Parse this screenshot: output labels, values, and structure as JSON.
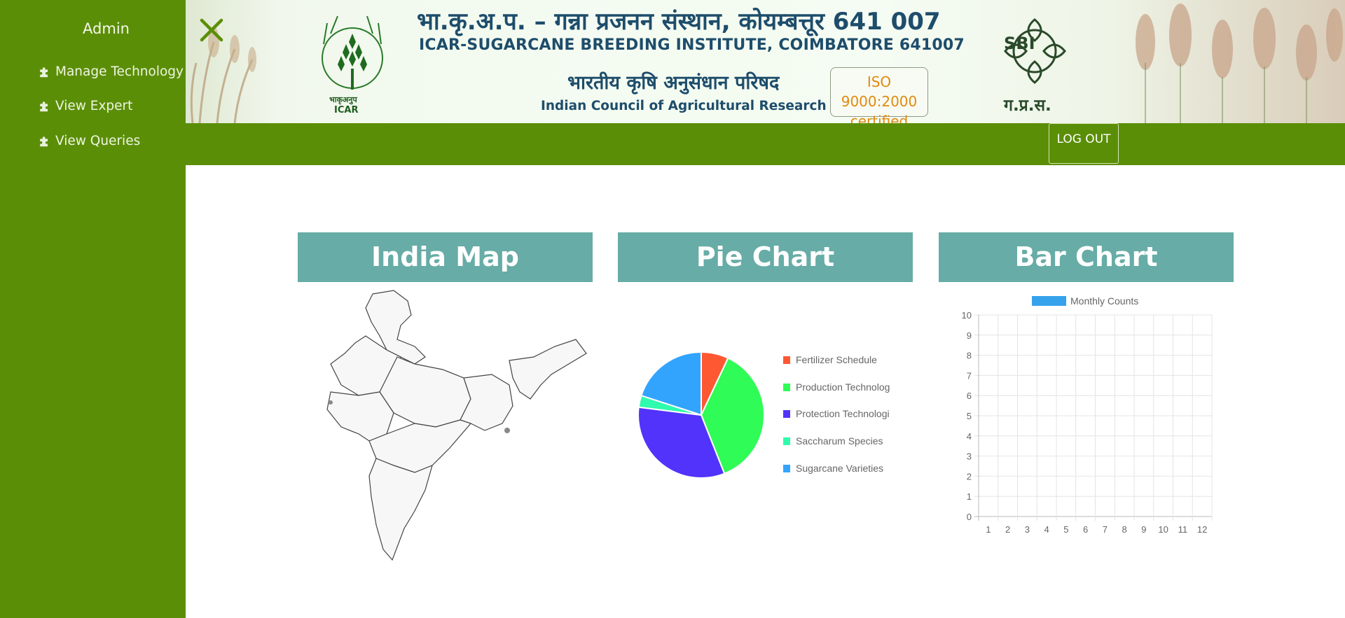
{
  "sidebar": {
    "title": "Admin",
    "items": [
      {
        "label": "Manage Technology",
        "icon": "puzzle-icon"
      },
      {
        "label": "View Expert",
        "icon": "puzzle-icon"
      },
      {
        "label": "View Queries",
        "icon": "puzzle-icon"
      }
    ]
  },
  "banner": {
    "hindi_line1": "भा.कृ.अ.प. –  गन्ना प्रजनन संस्थान, कोयम्बत्तूर 641 007",
    "english_line1": "ICAR-SUGARCANE BREEDING INSTITUTE, COIMBATORE 641007",
    "hindi_line2": "भारतीय कृषि अनुसंधान परिषद",
    "english_line2": "Indian Council of Agricultural Research",
    "iso_line1": "ISO 9000:2000",
    "iso_line2": "certified",
    "icar_logo_text1": "भाकृअनुप",
    "icar_logo_text2": "ICAR",
    "sbi_logo_text": "SBI",
    "sbi_logo_sub": "ग.प्र.स."
  },
  "header": {
    "close_icon": "close-icon",
    "logout_label": "LOG OUT"
  },
  "panels": {
    "map_title": "India Map",
    "pie_title": "Pie Chart",
    "bar_title": "Bar Chart"
  },
  "colors": {
    "sidebar": "#5b8e07",
    "panel_header": "#67aca6",
    "accent_close": "#5b8e07"
  },
  "chart_data": [
    {
      "type": "pie",
      "labels": [
        "Fertilizer Schedule",
        "Production Technology",
        "Protection Technology",
        "Saccharum Species",
        "Sugarcane Varieties"
      ],
      "legend_display": [
        "Fertilizer Schedule",
        "Production Technolog",
        "Protection Technologi",
        "Saccharum Species",
        "Sugarcane Varieties"
      ],
      "values": [
        7,
        37,
        33,
        3,
        20
      ],
      "colors": [
        "#fe5833",
        "#2ffc57",
        "#5133fc",
        "#2ffcac",
        "#33a4fe"
      ],
      "legend": "right"
    },
    {
      "type": "bar",
      "legend": "top",
      "series": [
        {
          "name": "Monthly Counts",
          "values": [
            0,
            0,
            0,
            0,
            0,
            0,
            0,
            0,
            0,
            0,
            0,
            0
          ],
          "color": "#36a2eb"
        }
      ],
      "categories": [
        "1",
        "2",
        "3",
        "4",
        "5",
        "6",
        "7",
        "8",
        "9",
        "10",
        "11",
        "12"
      ],
      "yticks": [
        "0",
        "1",
        "2",
        "3",
        "4",
        "5",
        "6",
        "7",
        "8",
        "9",
        "10"
      ],
      "ylim": [
        0,
        10
      ],
      "grid": true
    }
  ]
}
